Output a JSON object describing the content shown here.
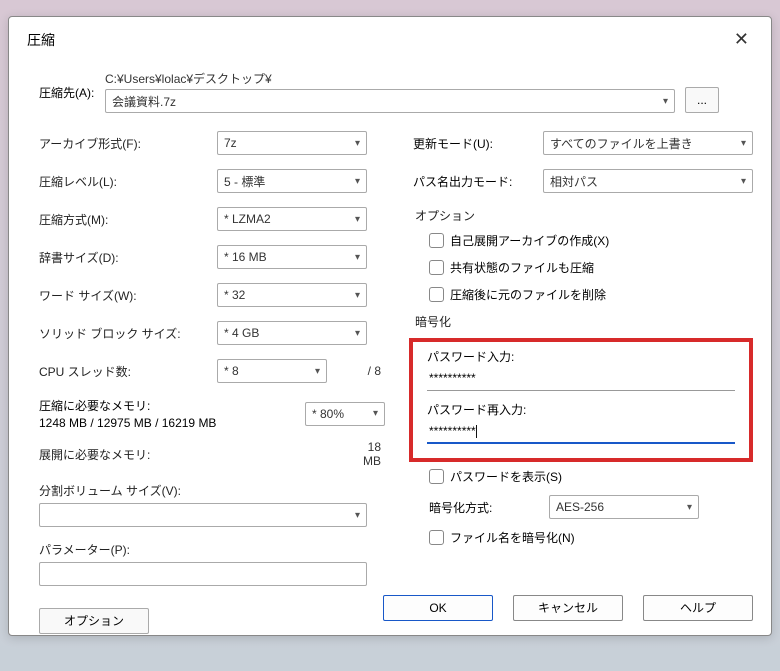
{
  "title": "圧縮",
  "dest": {
    "label": "圧縮先(A):",
    "path": "C:¥Users¥lolac¥デスクトップ¥",
    "file": "会議資料.7z",
    "browse": "..."
  },
  "left": {
    "archive_format_label": "アーカイブ形式(F):",
    "archive_format": "7z",
    "level_label": "圧縮レベル(L):",
    "level": "5 - 標準",
    "method_label": "圧縮方式(M):",
    "method": "* LZMA2",
    "dict_label": "辞書サイズ(D):",
    "dict": "* 16 MB",
    "word_label": "ワード サイズ(W):",
    "word": "* 32",
    "solid_label": "ソリッド ブロック サイズ:",
    "solid": "* 4 GB",
    "cpu_label": "CPU スレッド数:",
    "cpu": "* 8",
    "cpu_total": "/ 8",
    "mem_compress_label": "圧縮に必要なメモリ:",
    "mem_compress": "1248 MB / 12975 MB / 16219 MB",
    "mem_pct": "* 80%",
    "mem_decompress_label": "展開に必要なメモリ:",
    "mem_decompress": "18 MB",
    "split_label": "分割ボリューム サイズ(V):",
    "param_label": "パラメーター(P):",
    "options_btn": "オプション"
  },
  "right": {
    "update_label": "更新モード(U):",
    "update": "すべてのファイルを上書き",
    "pathmode_label": "パス名出力モード:",
    "pathmode": "相対パス",
    "options_title": "オプション",
    "sfx": "自己展開アーカイブの作成(X)",
    "shared": "共有状態のファイルも圧縮",
    "delete_after": "圧縮後に元のファイルを削除",
    "enc_title": "暗号化",
    "pw_label": "パスワード入力:",
    "pw_value": "**********",
    "pw2_label": "パスワード再入力:",
    "pw2_value": "**********",
    "show_pw": "パスワードを表示(S)",
    "enc_method_label": "暗号化方式:",
    "enc_method": "AES-256",
    "enc_names": "ファイル名を暗号化(N)"
  },
  "buttons": {
    "ok": "OK",
    "cancel": "キャンセル",
    "help": "ヘルプ"
  }
}
